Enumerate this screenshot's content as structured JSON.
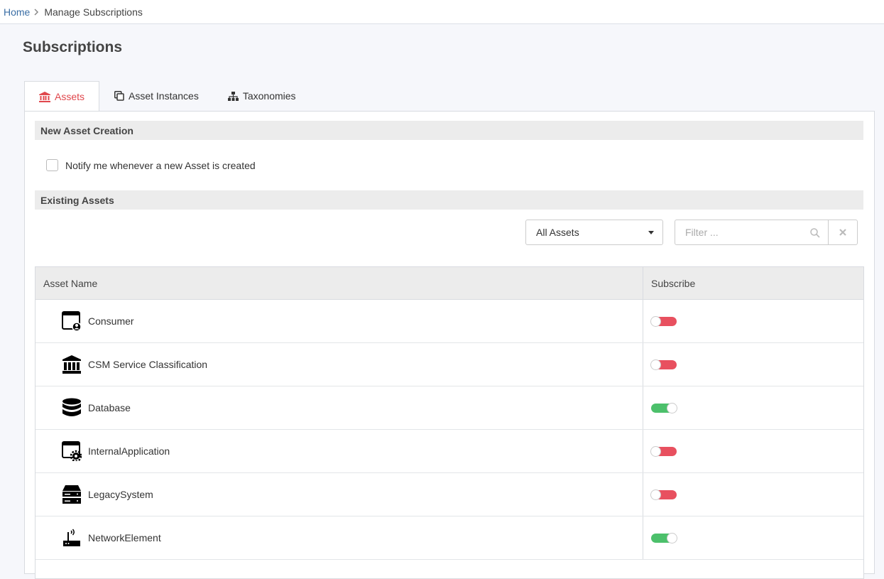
{
  "breadcrumb": {
    "home": "Home",
    "current": "Manage Subscriptions"
  },
  "page_title": "Subscriptions",
  "tabs": [
    {
      "label": "Assets",
      "icon": "bank-icon",
      "active": true
    },
    {
      "label": "Asset Instances",
      "icon": "copy-icon",
      "active": false
    },
    {
      "label": "Taxonomies",
      "icon": "sitemap-icon",
      "active": false
    }
  ],
  "new_asset": {
    "heading": "New Asset Creation",
    "notify_label": "Notify me whenever a new Asset is created",
    "notify_checked": false
  },
  "existing": {
    "heading": "Existing Assets",
    "select_value": "All Assets",
    "filter_placeholder": "Filter ...",
    "filter_value": ""
  },
  "table": {
    "columns": [
      "Asset Name",
      "Subscribe"
    ],
    "rows": [
      {
        "name": "Consumer",
        "icon": "consumer-app-icon",
        "subscribed": false
      },
      {
        "name": "CSM Service Classification",
        "icon": "bank-icon",
        "subscribed": false
      },
      {
        "name": "Database",
        "icon": "database-icon",
        "subscribed": true
      },
      {
        "name": "InternalApplication",
        "icon": "app-settings-icon",
        "subscribed": false
      },
      {
        "name": "LegacySystem",
        "icon": "server-icon",
        "subscribed": false
      },
      {
        "name": "NetworkElement",
        "icon": "router-icon",
        "subscribed": true
      }
    ]
  },
  "colors": {
    "accent": "#e0474c",
    "toggle_on": "#4cc06b",
    "toggle_off": "#e8505f",
    "link": "#3a6ea5"
  }
}
